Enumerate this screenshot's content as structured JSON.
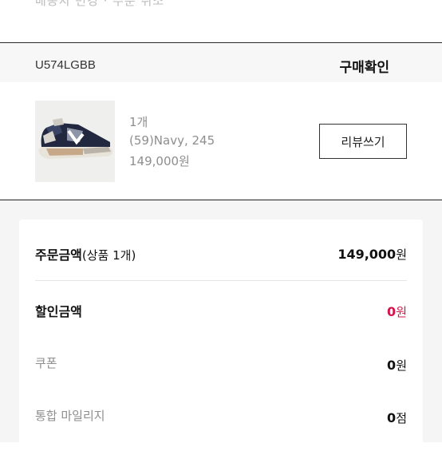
{
  "header": {
    "cut_text": "배송지 변경 · 주문 취소"
  },
  "order": {
    "code": "U574LGBB",
    "status": "구매확인",
    "product": {
      "quantity": "1개",
      "option": "(59)Navy, 245",
      "price": "149,000원",
      "image_icon": "sneaker-icon"
    },
    "review_button": "리뷰쓰기"
  },
  "summary": {
    "order_amount": {
      "label": "주문금액",
      "sub": "(상품 1개)",
      "value": "149,000",
      "unit": "원"
    },
    "discount": {
      "label": "할인금액",
      "value": "0",
      "unit": "원",
      "color": "#d4144a"
    },
    "coupon": {
      "label": "쿠폰",
      "value": "0",
      "unit": "원"
    },
    "mileage": {
      "label": "통합 마일리지",
      "value": "0",
      "unit": "점"
    }
  },
  "colors": {
    "accent": "#d4144a",
    "divider": "#222222",
    "muted": "#8e8e8e"
  }
}
